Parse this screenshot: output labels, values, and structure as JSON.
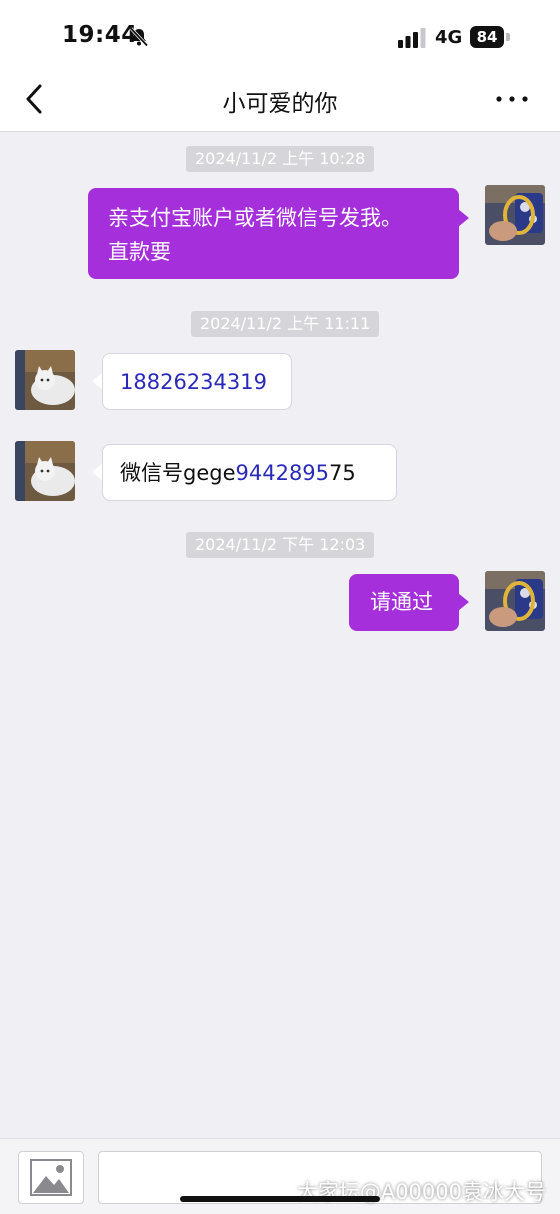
{
  "status_bar": {
    "time": "19:44",
    "network": "4G",
    "battery": "84"
  },
  "nav": {
    "title": "小可爱的你"
  },
  "messages": [
    {
      "type": "timestamp",
      "text": "2024/11/2 上午 10:28"
    },
    {
      "type": "outgoing",
      "line1": "亲支付宝账户或者微信号发我。",
      "line2": "直款要"
    },
    {
      "type": "timestamp",
      "text": "2024/11/2 上午 11:11"
    },
    {
      "type": "incoming",
      "link_text": "18826234319"
    },
    {
      "type": "incoming",
      "prefix": "微信号gege",
      "link_text": "9442895",
      "suffix": "75"
    },
    {
      "type": "timestamp",
      "text": "2024/11/2 下午 12:03"
    },
    {
      "type": "outgoing",
      "text": "请通过"
    }
  ],
  "input": {
    "placeholder": ""
  },
  "watermark": "大家坛@A00000袁冰大号",
  "colors": {
    "outgoing_bubble": "#a62fdc",
    "link": "#2a2ab8",
    "background": "#efeff4"
  },
  "icons": {
    "back": "chevron-left-icon",
    "more": "more-dots-icon",
    "image": "image-icon",
    "mute": "bell-off-icon"
  }
}
